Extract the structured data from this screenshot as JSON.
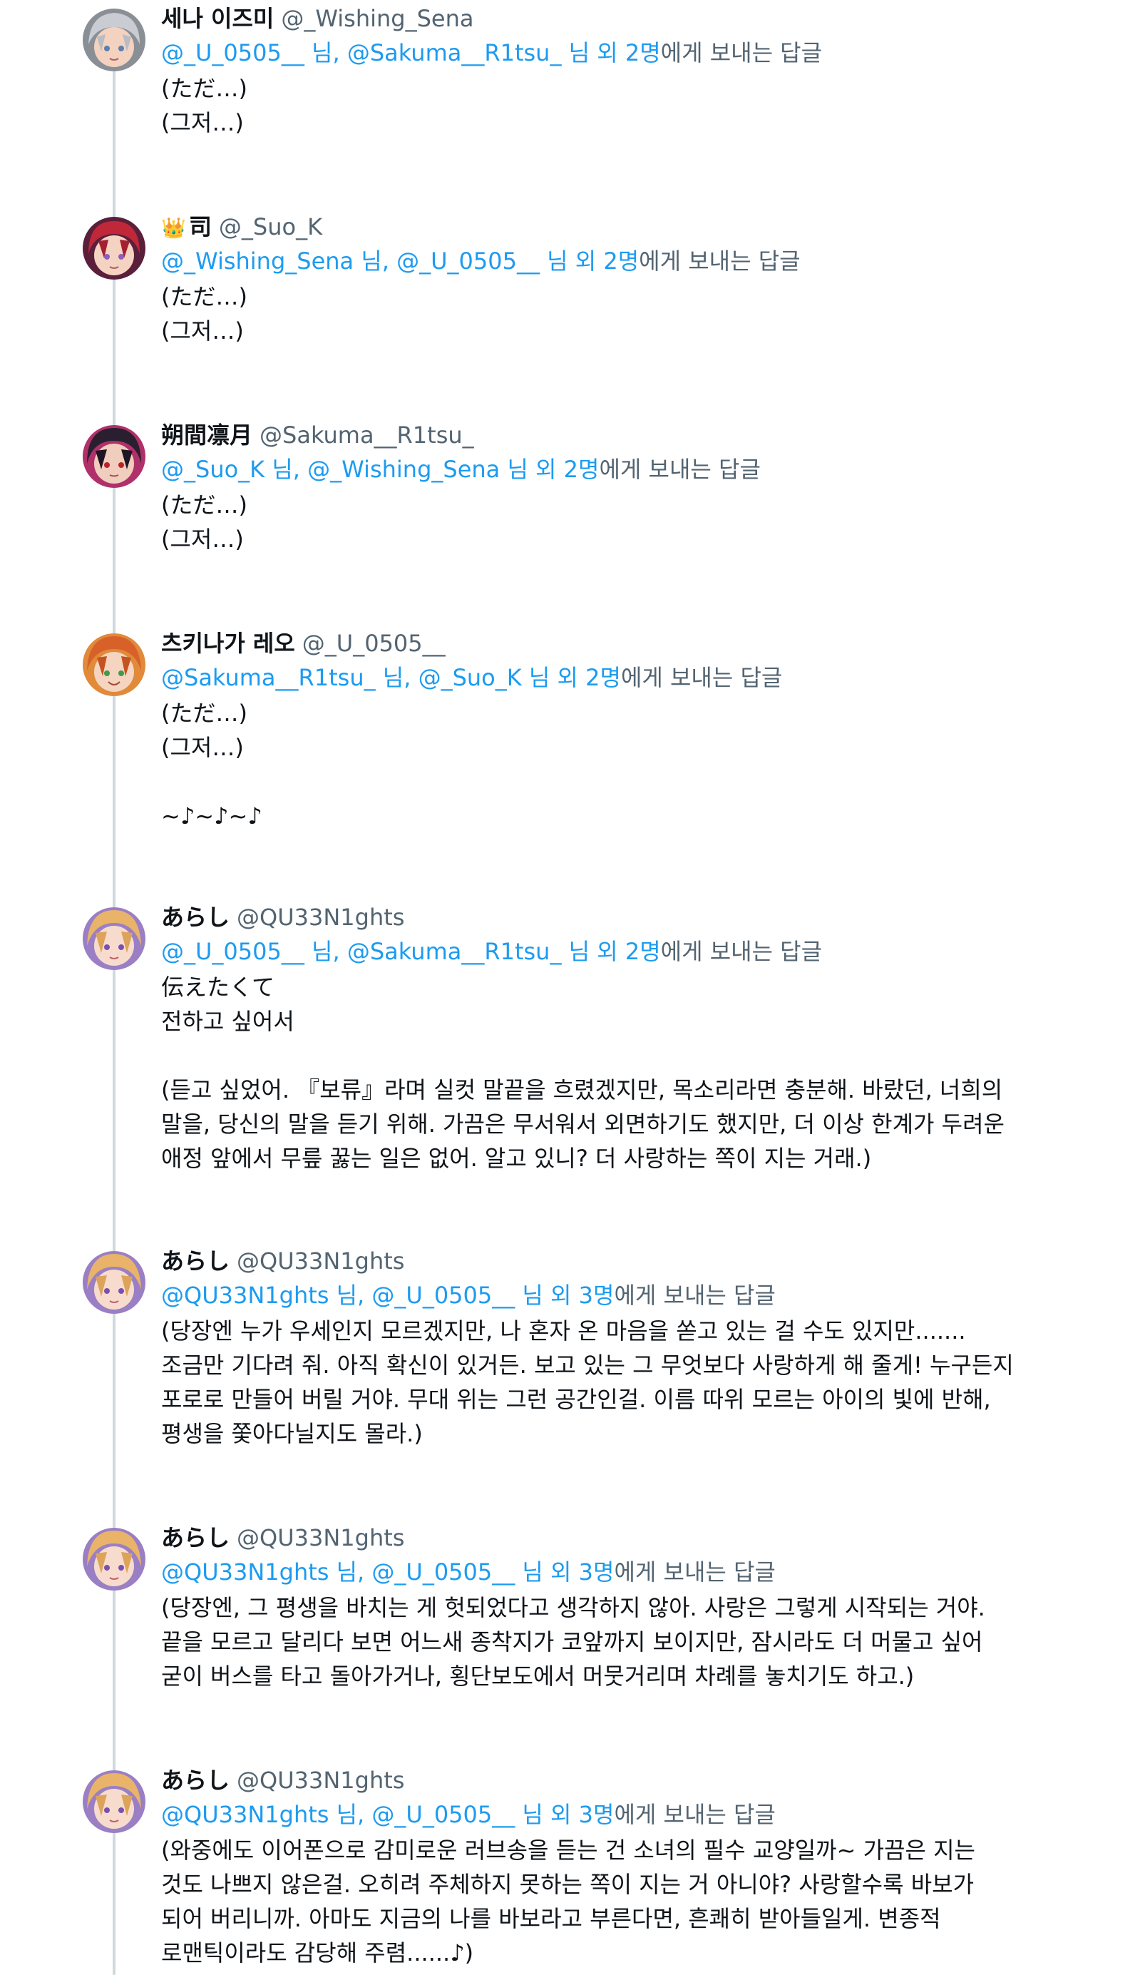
{
  "reply_suffix": "에게 보내는 답글",
  "colors": {
    "link": "#1d9bf0",
    "secondary_text": "#536471",
    "primary_text": "#0f1419",
    "thread_line": "#cfd9de"
  },
  "tweets": [
    {
      "avatar_icon": "avatar-silver-hair",
      "name": "세나 이즈미",
      "handle": "@_Wishing_Sena",
      "mentions": "@_U_0505__ 님, @Sakuma__R1tsu_ 님 외 2명",
      "lines": [
        "(ただ…)",
        "(그저…)"
      ]
    },
    {
      "avatar_icon": "avatar-red-hair",
      "name_icon": "crown-icon",
      "name": "司",
      "handle": "@_Suo_K",
      "mentions": "@_Wishing_Sena 님, @_U_0505__ 님 외 2명",
      "lines": [
        "(ただ…)",
        "(그저…)"
      ]
    },
    {
      "avatar_icon": "avatar-dark-hair",
      "name": "朔間凛月",
      "handle": "@Sakuma__R1tsu_",
      "mentions": "@_Suo_K 님, @_Wishing_Sena 님 외 2명",
      "lines": [
        "(ただ…)",
        "(그저…)"
      ]
    },
    {
      "avatar_icon": "avatar-orange-hair",
      "name": "츠키나가 레오",
      "handle": "@_U_0505__",
      "mentions": "@Sakuma__R1tsu_ 님, @_Suo_K 님 외 2명",
      "lines": [
        "(ただ…)",
        "(그저…)",
        "",
        "~♪~♪~♪"
      ]
    },
    {
      "avatar_icon": "avatar-blonde-hair",
      "name": "あらし",
      "handle": "@QU33N1ghts",
      "mentions": "@_U_0505__ 님, @Sakuma__R1tsu_ 님 외 2명",
      "lines": [
        "伝えたくて",
        "전하고 싶어서",
        "",
        "(듣고 싶었어. 『보류』라며 실컷 말끝을 흐렸겠지만, 목소리라면 충분해. 바랐던, 너희의",
        "말을, 당신의 말을 듣기 위해. 가끔은 무서워서 외면하기도 했지만, 더 이상 한계가 두려운",
        "애정 앞에서 무릎 꿇는 일은 없어. 알고 있니? 더 사랑하는 쪽이 지는 거래.)"
      ]
    },
    {
      "avatar_icon": "avatar-blonde-hair",
      "name": "あらし",
      "handle": "@QU33N1ghts",
      "mentions": "@QU33N1ghts 님, @_U_0505__ 님 외 3명",
      "lines": [
        "(당장엔 누가 우세인지 모르겠지만, 나 혼자 온 마음을 쏟고 있는 걸 수도 있지만.......",
        "조금만 기다려 줘. 아직 확신이 있거든. 보고 있는 그 무엇보다 사랑하게 해 줄게! 누구든지",
        "포로로 만들어 버릴 거야. 무대 위는 그런 공간인걸. 이름 따위 모르는 아이의 빛에 반해,",
        "평생을 쫓아다닐지도 몰라.)"
      ]
    },
    {
      "avatar_icon": "avatar-blonde-hair",
      "name": "あらし",
      "handle": "@QU33N1ghts",
      "mentions": "@QU33N1ghts 님, @_U_0505__ 님 외 3명",
      "lines": [
        "(당장엔, 그 평생을 바치는 게 헛되었다고 생각하지 않아. 사랑은 그렇게 시작되는 거야.",
        "끝을 모르고 달리다 보면 어느새 종착지가 코앞까지 보이지만, 잠시라도 더 머물고 싶어",
        "굳이 버스를 타고 돌아가거나, 횡단보도에서 머뭇거리며 차례를 놓치기도 하고.)"
      ]
    },
    {
      "avatar_icon": "avatar-blonde-hair",
      "name": "あらし",
      "handle": "@QU33N1ghts",
      "mentions": "@QU33N1ghts 님, @_U_0505__ 님 외 3명",
      "lines": [
        "(와중에도 이어폰으로 감미로운 러브송을 듣는 건 소녀의 필수 교양일까~ 가끔은 지는",
        "것도 나쁘지 않은걸. 오히려 주체하지 못하는 쪽이 지는 거 아니야? 사랑할수록 바보가",
        "되어 버리니까. 아마도 지금의 나를 바보라고 부른다면, 흔쾌히 받아들일게. 변종적",
        "로맨틱이라도 감당해 주렴......♪)"
      ]
    }
  ]
}
